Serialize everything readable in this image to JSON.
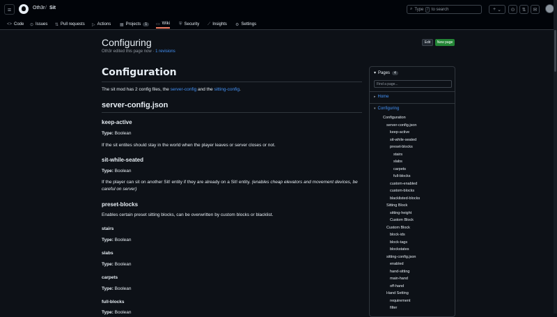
{
  "header": {
    "owner": "Oth3r",
    "sep": "/",
    "repo": "Sit",
    "search_placeholder": "Type",
    "search_key": "/",
    "search_suffix": "to search",
    "plus": "+",
    "caret": "⌄"
  },
  "tabs": [
    {
      "label": "Code",
      "icon": "<>"
    },
    {
      "label": "Issues",
      "icon": "⊙"
    },
    {
      "label": "Pull requests",
      "icon": "⇅"
    },
    {
      "label": "Actions",
      "icon": "▷"
    },
    {
      "label": "Projects",
      "icon": "▦",
      "count": "1"
    },
    {
      "label": "Wiki",
      "icon": "▭"
    },
    {
      "label": "Security",
      "icon": "⛨"
    },
    {
      "label": "Insights",
      "icon": "⟋"
    },
    {
      "label": "Settings",
      "icon": "⚙"
    }
  ],
  "page": {
    "title": "Configuring",
    "edited": "Oth3r edited this page now ·",
    "revisions": "1 revisions",
    "edit": "Edit",
    "new_page": "New page"
  },
  "article": {
    "h1": "Configuration",
    "intro_pre": "The sit mod has 2 config files, the",
    "intro_link1": "server-config",
    "intro_mid": "and the",
    "intro_link2": "sitting-config",
    "intro_end": ".",
    "server_config": "server-config.json",
    "keep_active": "keep-active",
    "type_label": "Type:",
    "type_boolean": "Boolean",
    "keep_active_desc": "If the sit entites should stay in the world when the player leaves or server closes or not.",
    "sit_while_seated": "sit-while-seated",
    "sit_while_seated_desc": "If the player can sit on another Sit! entity if they are already on a Sit! entity.",
    "sit_while_seated_note": "(enables cheap elevators and movement devices, be careful on server)",
    "preset_blocks": "preset-blocks",
    "preset_blocks_desc": "Enables certain preset sitting blocks, can be overwritten by custom blocks or blacklist.",
    "stairs": "stairs",
    "slabs": "slabs",
    "carpets": "carpets",
    "full_blocks": "full-blocks"
  },
  "sidebar": {
    "pages": "Pages",
    "count": "4",
    "find": "Find a page...",
    "home": "Home",
    "configuring": "Configuring",
    "items": [
      "Configuration",
      "server-config.json",
      "keep-active",
      "sit-while-seated",
      "preset-blocks",
      "stairs",
      "slabs",
      "carpets",
      "full-blocks",
      "custom-enabled",
      "custom-blocks",
      "blacklisted-blocks",
      "Sitting Block",
      "sitting-height",
      "Custom Block",
      "Custom Block",
      "block-ids",
      "block-tags",
      "blockstates",
      "sitting-config.json",
      "enabled",
      "hand-sitting",
      "main-hand",
      "off-hand",
      "Hand Setting",
      "requirement",
      "filter"
    ]
  }
}
